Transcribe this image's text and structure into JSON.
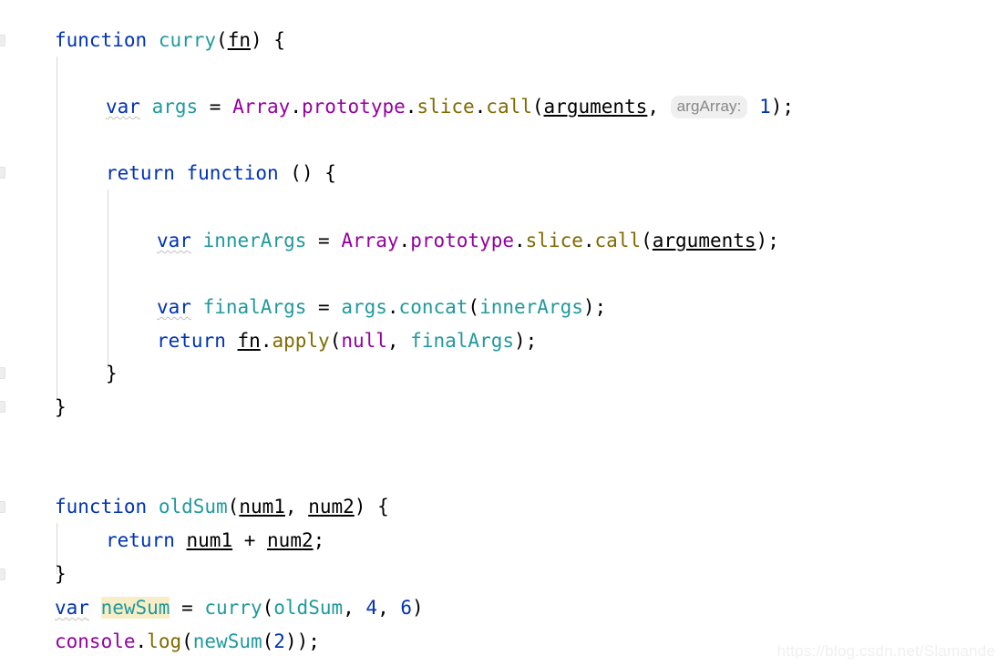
{
  "editor": {
    "language": "javascript",
    "background": "#ffffff",
    "font_size_px": 21,
    "line_height_px": 36,
    "colors": {
      "keyword": "#0033b3",
      "identifier": "#20999d",
      "class_name": "#9400a0",
      "method": "#806a00",
      "number": "#0033b3",
      "plain_text": "#000000",
      "inlay_hint_bg": "#efefef",
      "inlay_hint_fg": "#878787",
      "identifier_highlight_bg": "#f7eec8",
      "indent_guide": "#d8d8d8",
      "gutter_mark": "#eeeeee",
      "watermark": "#f0f0f0"
    }
  },
  "code": {
    "line_01": {
      "kw_function": "function",
      "name": "curry",
      "paren_open": "(",
      "param": "fn",
      "paren_close": ")",
      "brace": " {"
    },
    "line_03": {
      "kw_var": "var",
      "name": " args ",
      "eq": "= ",
      "cls_array": "Array",
      "dot1": ".",
      "cls_prototype": "prototype",
      "dot2": ".",
      "m_slice": "slice",
      "dot3": ".",
      "m_call": "call",
      "paren_open": "(",
      "arg_arguments": "arguments",
      "comma": ", ",
      "inlay_hint": "argArray:",
      "number": "1",
      "tail": ");"
    },
    "line_05": {
      "kw_return": "return",
      "kw_function": " function",
      "parens": " () {"
    },
    "line_07": {
      "kw_var": "var",
      "name": " innerArgs ",
      "eq": "= ",
      "cls_array": "Array",
      "dot1": ".",
      "cls_prototype": "prototype",
      "dot2": ".",
      "m_slice": "slice",
      "dot3": ".",
      "m_call": "call",
      "paren_open": "(",
      "arg_arguments": "arguments",
      "tail": ");"
    },
    "line_09": {
      "kw_var": "var",
      "name": " finalArgs ",
      "eq": "= ",
      "id_args": "args",
      "dot1": ".",
      "m_concat": "concat",
      "paren_open": "(",
      "id_inner": "innerArgs",
      "tail": ");"
    },
    "line_10": {
      "kw_return": "return",
      "id_fn": "fn",
      "dot1": ".",
      "m_apply": "apply",
      "paren_open": "(",
      "kw_null": "null",
      "comma": ", ",
      "id_final": "finalArgs",
      "tail": ");"
    },
    "line_11": {
      "brace": "}"
    },
    "line_12": {
      "brace": "}"
    },
    "line_15": {
      "kw_function": "function",
      "name": "oldSum",
      "paren_open": "(",
      "param1": "num1",
      "comma": ", ",
      "param2": "num2",
      "paren_close": ")",
      "brace": " {"
    },
    "line_16": {
      "kw_return": "return",
      "param1": "num1",
      "plus": " + ",
      "param2": "num2",
      "semi": ";"
    },
    "line_17": {
      "brace": "}"
    },
    "line_18": {
      "kw_var": "var",
      "name": "newSum",
      "eq": " = ",
      "fn_curry": "curry",
      "paren_open": "(",
      "arg_oldSum": "oldSum",
      "comma1": ", ",
      "num_4": "4",
      "comma2": ", ",
      "num_6": "6",
      "paren_close": ")"
    },
    "line_19": {
      "cls_console": "console",
      "dot": ".",
      "m_log": "log",
      "paren_open": "(",
      "fn_newSum": "newSum",
      "paren_inner_open": "(",
      "num_2": "2",
      "tail": "));"
    }
  },
  "watermark": {
    "text": "https://blog.csdn.net/Slamande"
  }
}
